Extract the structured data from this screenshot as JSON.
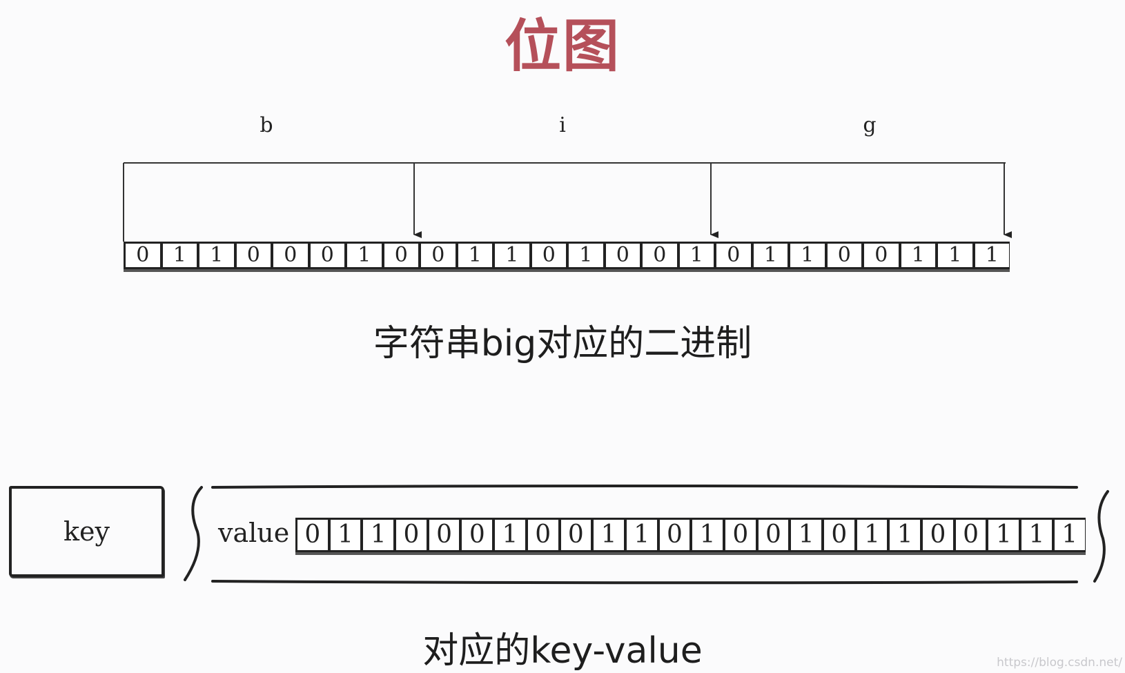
{
  "title": "位图",
  "letters": [
    "b",
    "i",
    "g"
  ],
  "bits_top": [
    "0",
    "1",
    "1",
    "0",
    "0",
    "0",
    "1",
    "0",
    "0",
    "1",
    "1",
    "0",
    "1",
    "0",
    "0",
    "1",
    "0",
    "1",
    "1",
    "0",
    "0",
    "1",
    "1",
    "1"
  ],
  "caption_top": "字符串big对应的二进制",
  "key_label": "key",
  "value_label": "value",
  "bits_bottom": [
    "0",
    "1",
    "1",
    "0",
    "0",
    "0",
    "1",
    "0",
    "0",
    "1",
    "1",
    "0",
    "1",
    "0",
    "0",
    "1",
    "0",
    "1",
    "1",
    "0",
    "0",
    "1",
    "1",
    "1"
  ],
  "caption_bottom": "对应的key-value",
  "watermark": "https://blog.csdn.net/"
}
